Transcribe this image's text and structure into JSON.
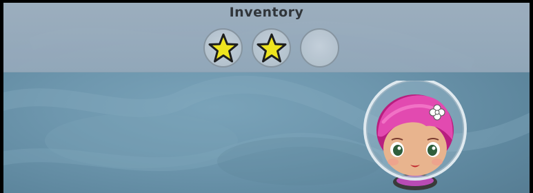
{
  "inventory": {
    "title": "Inventory",
    "slots": [
      {
        "item": "star-icon",
        "filled": true
      },
      {
        "item": "star-icon",
        "filled": true
      },
      {
        "item": "",
        "filled": false
      }
    ]
  },
  "avatar": {
    "icon": "astronaut-girl-avatar",
    "hair_color": "#d9379c",
    "bow_icon": "flower-bow-icon"
  },
  "colors": {
    "background": "#6e97ae",
    "inventory_bar": "#9fb0c0",
    "star_fill": "#f4e81a",
    "star_outline": "#1a1a1a"
  }
}
